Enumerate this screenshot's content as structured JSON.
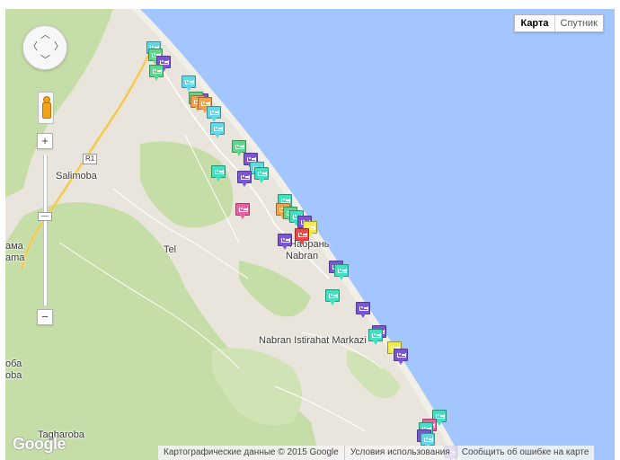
{
  "map_type_control": {
    "map_label": "Карта",
    "satellite_label": "Спутник",
    "selected": "Карта"
  },
  "zoom": {
    "in_label": "+",
    "out_label": "−"
  },
  "road_shield": "R1",
  "places": [
    {
      "name": "Salimoba"
    },
    {
      "name": "Tel"
    },
    {
      "name": "Набрань"
    },
    {
      "name": "Nabran"
    },
    {
      "name": "Nabran Istirahat Markazi"
    },
    {
      "name": "Tagharoba"
    },
    {
      "name": "ама"
    },
    {
      "name": "ama"
    },
    {
      "name": "оба"
    },
    {
      "name": "oba"
    }
  ],
  "footer": {
    "map_data": "Картографические данные © 2015 Google",
    "terms": "Условия использования",
    "report": "Сообщить об ошибке на карте"
  },
  "logo_text": "Google",
  "colors": {
    "water": "#a3c6ff",
    "land": "#e9e5dc",
    "forest": "#c5dea8",
    "road": "#f8d56a",
    "marker_cyan": "#62d8e6",
    "marker_purple": "#7b57d6",
    "marker_green": "#5fd78a",
    "marker_orange": "#f2a24a",
    "marker_teal": "#40e0c0",
    "marker_pink": "#ec5fa3",
    "marker_red": "#e84a4a",
    "marker_yellow": "#f0ea4a"
  },
  "marker_icon": "hotel-bed-icon",
  "markers": [
    {
      "color": "cyan"
    },
    {
      "color": "green"
    },
    {
      "color": "purple"
    },
    {
      "color": "green"
    },
    {
      "color": "cyan"
    },
    {
      "color": "purple"
    },
    {
      "color": "green"
    },
    {
      "color": "orange"
    },
    {
      "color": "orange"
    },
    {
      "color": "cyan"
    },
    {
      "color": "cyan"
    },
    {
      "color": "green"
    },
    {
      "color": "purple"
    },
    {
      "color": "cyan"
    },
    {
      "color": "teal"
    },
    {
      "color": "teal"
    },
    {
      "color": "purple"
    },
    {
      "color": "pink"
    },
    {
      "color": "teal"
    },
    {
      "color": "orange"
    },
    {
      "color": "green"
    },
    {
      "color": "teal"
    },
    {
      "color": "purple"
    },
    {
      "color": "yellow"
    },
    {
      "color": "purple"
    },
    {
      "color": "red"
    },
    {
      "color": "purple"
    },
    {
      "color": "teal"
    },
    {
      "color": "teal"
    },
    {
      "color": "purple"
    },
    {
      "color": "purple"
    },
    {
      "color": "teal"
    },
    {
      "color": "yellow"
    },
    {
      "color": "purple"
    },
    {
      "color": "teal"
    },
    {
      "color": "pink"
    },
    {
      "color": "teal"
    },
    {
      "color": "purple"
    },
    {
      "color": "cyan"
    },
    {
      "color": "purple"
    }
  ]
}
